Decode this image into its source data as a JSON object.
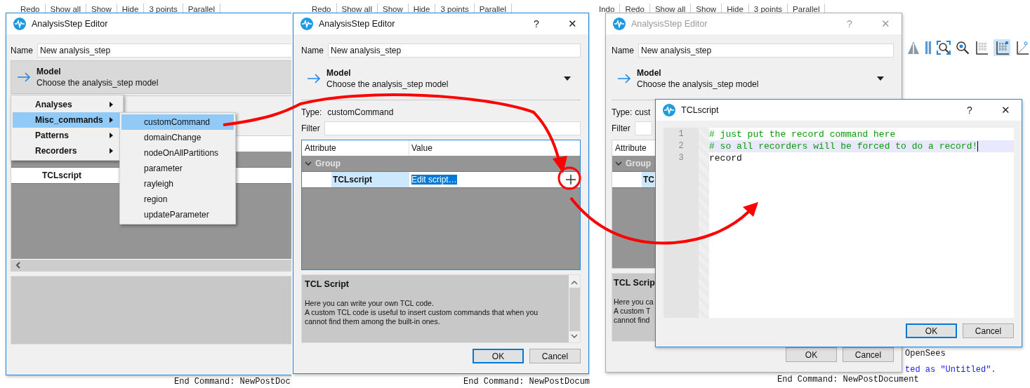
{
  "panels": [
    {
      "toolbar": [
        "Redo",
        "Show all",
        "Show",
        "Hide",
        "3 points",
        "Parallel"
      ],
      "console": [
        {
          "text": "End Command: NewPostDoc",
          "kind": "plain"
        }
      ],
      "editor": {
        "title": "AnalysisStep Editor",
        "active": true,
        "name_label": "Name",
        "name_value": "New analysis_step",
        "model_title": "Model",
        "model_subtitle": "Choose the analysis_step model",
        "model_open": true,
        "attribute": "TCLscript",
        "attribute_selected": false,
        "horizontal_scrollbar": true
      },
      "menu": {
        "items": [
          {
            "label": "Analyses",
            "selected": false
          },
          {
            "label": "Misc_commands",
            "selected": true
          },
          {
            "label": "Patterns",
            "selected": false
          },
          {
            "label": "Recorders",
            "selected": false
          }
        ],
        "submenu": [
          {
            "label": "customCommand",
            "selected": true
          },
          {
            "label": "domainChange",
            "selected": false
          },
          {
            "label": "nodeOnAllPartitions",
            "selected": false
          },
          {
            "label": "parameter",
            "selected": false
          },
          {
            "label": "rayleigh",
            "selected": false
          },
          {
            "label": "region",
            "selected": false
          },
          {
            "label": "updateParameter",
            "selected": false
          }
        ]
      }
    },
    {
      "toolbar": [
        "Redo",
        "Show all",
        "Show",
        "Hide",
        "3 points",
        "Parallel"
      ],
      "console": [
        {
          "text": "End Command: NewPostDocum",
          "kind": "plain"
        }
      ],
      "editor": {
        "title": "AnalysisStep Editor",
        "active": true,
        "help": "?",
        "close": "✕",
        "name_label": "Name",
        "name_value": "New analysis_step",
        "model_title": "Model",
        "model_subtitle": "Choose the analysis_step model",
        "model_open": false,
        "type_label": "Type:",
        "type_value": "customCommand",
        "filter_label": "Filter",
        "columns": [
          "Attribute",
          "Value"
        ],
        "group": "Group",
        "attribute": "TCLscript",
        "attribute_selected": true,
        "value": "Edit script…",
        "value_selected": true,
        "description_title": "TCL Script",
        "description": [
          "Here you can write your own TCL code.",
          "A custom TCL code is useful to insert custom commands that when you",
          "cannot find them among the built-in ones."
        ],
        "vertical_scrollbar": true,
        "buttons": [
          {
            "label": "OK",
            "default": true
          },
          {
            "label": "Cancel",
            "default": false
          }
        ]
      }
    },
    {
      "toolbar": [
        "Indo",
        "Redo",
        "Show all",
        "Show",
        "Hide",
        "3 points",
        "Parallel"
      ],
      "console": [
        {
          "text": "OpenSees",
          "kind": "plain"
        },
        {
          "text": "ted as \"Untitled\".",
          "kind": "info"
        },
        {
          "text": "End Command: NewPostDocument",
          "kind": "plain"
        }
      ],
      "editor": {
        "title": "AnalysisStep Editor",
        "active": false,
        "help": "?",
        "close": "✕",
        "name_label": "Name",
        "name_value": "New analysis_step",
        "model_title": "Model",
        "model_subtitle": "Choose the analysis_step model",
        "model_open": false,
        "type_label": "Type:",
        "type_value": "cust",
        "filter_label": "Filter",
        "columns": [
          "Attribute"
        ],
        "group": "Group",
        "attribute": "TC",
        "attribute_selected": true,
        "description_title": "TCL Scrip",
        "description": [
          "Here you ca",
          "A custom T",
          "cannot find"
        ],
        "buttons": [
          {
            "label": "OK",
            "default": false
          },
          {
            "label": "Cancel",
            "default": false
          }
        ]
      },
      "script_dialog": {
        "title": "TCLscript",
        "help": "?",
        "close": "✕",
        "lines": [
          {
            "number": "1",
            "text": "# just put the record command here",
            "kind": "comment",
            "current": false
          },
          {
            "number": "2",
            "text": "# so all recorders will be forced to do a record!",
            "kind": "comment",
            "current": true
          },
          {
            "number": "3",
            "text": "record",
            "kind": "code",
            "current": false
          }
        ],
        "buttons": [
          {
            "label": "OK",
            "default": true
          },
          {
            "label": "Cancel",
            "default": false
          }
        ]
      }
    }
  ]
}
